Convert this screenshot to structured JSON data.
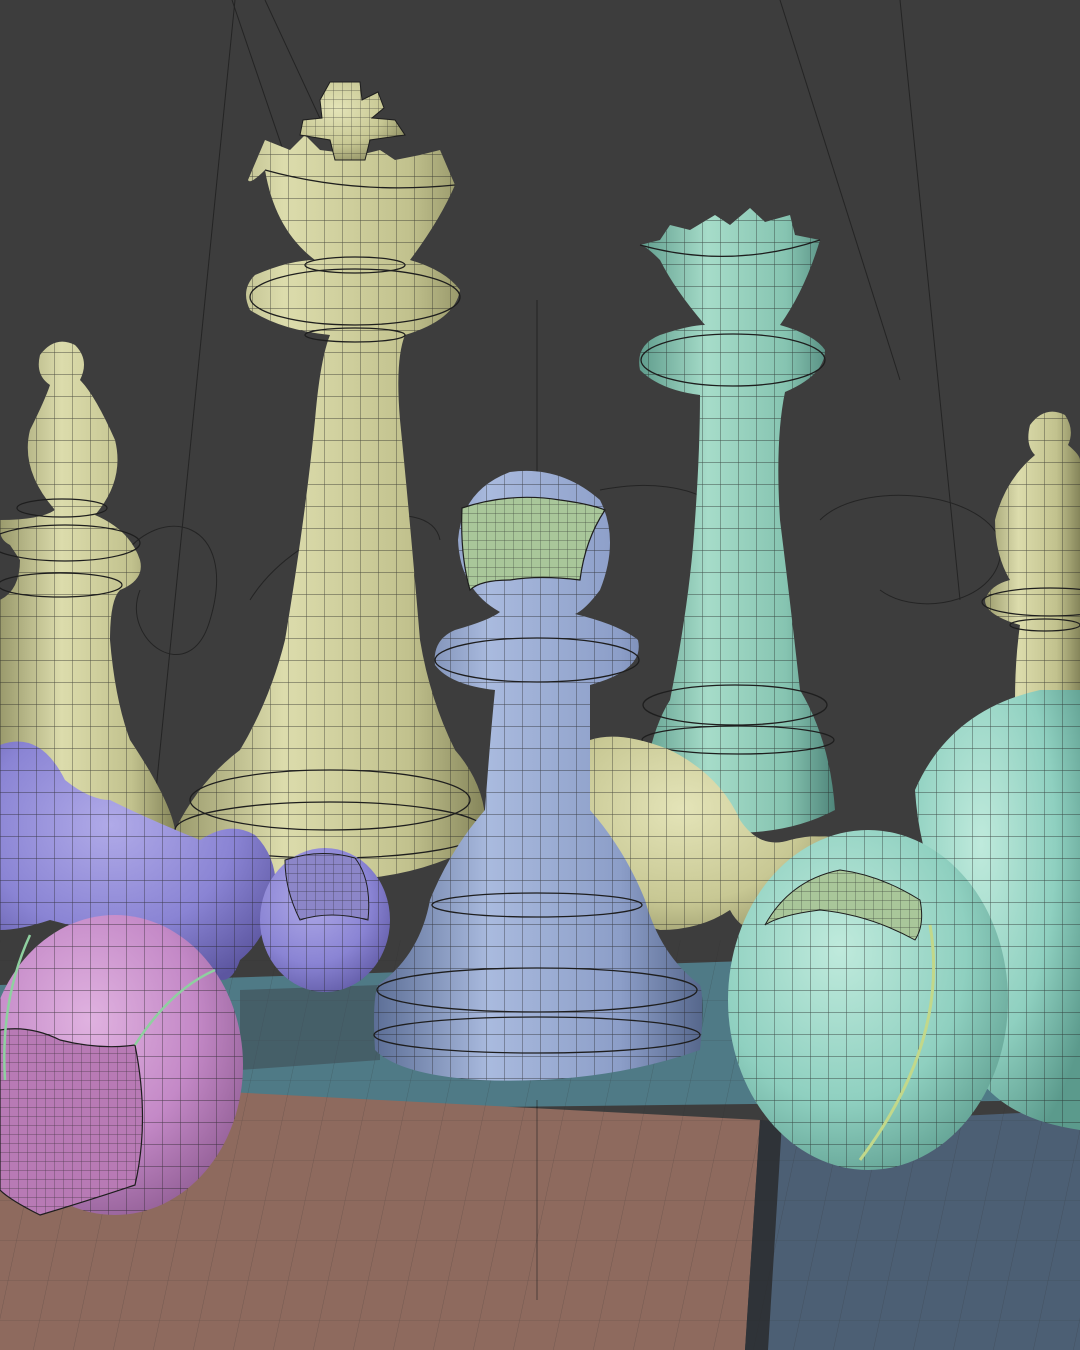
{
  "viewport": {
    "background": "#3d3d3d",
    "floor_colors": {
      "brown_tile": "#8e6a5e",
      "blue_tile": "#4c5f74",
      "teal_tile": "#4f7a86",
      "dark_edge": "#2f3338"
    }
  },
  "pieces": [
    {
      "name": "bishop-left",
      "kind": "bishop",
      "color": "#c8c894"
    },
    {
      "name": "king",
      "kind": "king",
      "color": "#c8c894"
    },
    {
      "name": "queen",
      "kind": "queen",
      "color": "#8ec9b6"
    },
    {
      "name": "bishop-right",
      "kind": "bishop",
      "color": "#c8c894"
    },
    {
      "name": "pawn-center",
      "kind": "pawn",
      "color": "#8ea2cc"
    },
    {
      "name": "pawn-fallen-yellow",
      "kind": "pawn",
      "color": "#c8c894"
    },
    {
      "name": "pawn-fallen-purple",
      "kind": "pawn",
      "color": "#8a84d4"
    },
    {
      "name": "ball-pink",
      "kind": "ball",
      "color": "#c489c7"
    },
    {
      "name": "pawn-fallen-teal",
      "kind": "pawn",
      "color": "#8fd0c0"
    }
  ],
  "wire_color": "#1e1e1e",
  "mask_color": "#a9c79a"
}
